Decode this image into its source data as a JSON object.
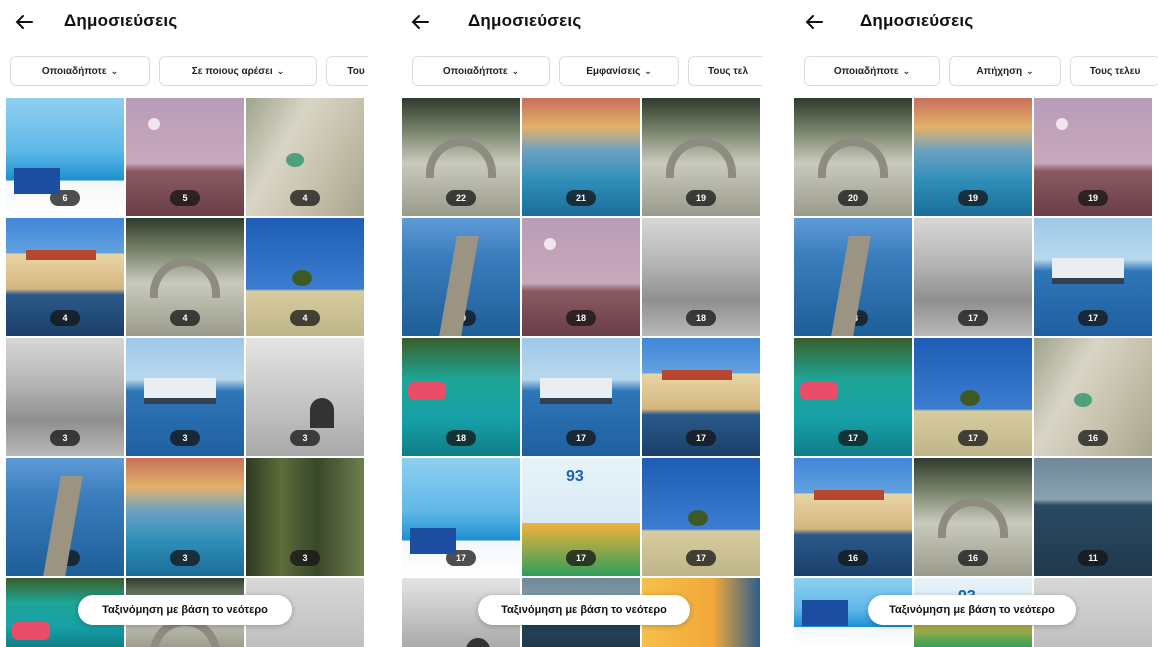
{
  "panels": [
    {
      "title": "Δημοσιεύσεις",
      "filters": [
        {
          "label": "Οποιαδήποτε"
        },
        {
          "label": "Σε ποιους αρέσει"
        },
        {
          "label": "Του"
        }
      ],
      "posts": [
        {
          "thumb": "travel",
          "count": "6"
        },
        {
          "thumb": "moon",
          "count": "5"
        },
        {
          "thumb": "sand",
          "count": "4"
        },
        {
          "thumb": "townhall",
          "count": "4"
        },
        {
          "thumb": "bridge",
          "count": "4"
        },
        {
          "thumb": "tree",
          "count": "4"
        },
        {
          "thumb": "bwruins",
          "count": "3"
        },
        {
          "thumb": "boat",
          "count": "3"
        },
        {
          "thumb": "bwrock",
          "count": "3"
        },
        {
          "thumb": "harbor",
          "count": "3"
        },
        {
          "thumb": "colortown",
          "count": "3"
        },
        {
          "thumb": "forest",
          "count": "3"
        }
      ],
      "sort_label": "Ταξινόμηση με βάση το νεότερο"
    },
    {
      "title": "Δημοσιεύσεις",
      "filters": [
        {
          "label": "Οποιαδήποτε"
        },
        {
          "label": "Εμφανίσεις"
        },
        {
          "label": "Τους τελ"
        }
      ],
      "posts": [
        {
          "thumb": "bridge",
          "count": "22"
        },
        {
          "thumb": "colortown",
          "count": "21"
        },
        {
          "thumb": "bridge",
          "count": "19"
        },
        {
          "thumb": "harbor",
          "count": "19"
        },
        {
          "thumb": "moon",
          "count": "18"
        },
        {
          "thumb": "bwruins",
          "count": "18"
        },
        {
          "thumb": "aqua",
          "count": "18"
        },
        {
          "thumb": "boat",
          "count": "17"
        },
        {
          "thumb": "townhall",
          "count": "17"
        },
        {
          "thumb": "travel",
          "count": "17"
        },
        {
          "thumb": "promo",
          "count": "17"
        },
        {
          "thumb": "tree",
          "count": "17"
        }
      ],
      "sort_label": "Ταξινόμηση με βάση το νεότερο"
    },
    {
      "title": "Δημοσιεύσεις",
      "filters": [
        {
          "label": "Οποιαδήποτε"
        },
        {
          "label": "Απήχηση"
        },
        {
          "label": "Τους τελευ"
        }
      ],
      "posts": [
        {
          "thumb": "bridge",
          "count": "20"
        },
        {
          "thumb": "colortown",
          "count": "19"
        },
        {
          "thumb": "moon",
          "count": "19"
        },
        {
          "thumb": "harbor",
          "count": "18"
        },
        {
          "thumb": "bwruins",
          "count": "17"
        },
        {
          "thumb": "boat",
          "count": "17"
        },
        {
          "thumb": "aqua",
          "count": "17"
        },
        {
          "thumb": "tree",
          "count": "17"
        },
        {
          "thumb": "sand",
          "count": "16"
        },
        {
          "thumb": "townhall",
          "count": "16"
        },
        {
          "thumb": "bridge",
          "count": "16"
        },
        {
          "thumb": "marina",
          "count": "11"
        }
      ],
      "sort_label": "Ταξινόμηση με βάση το νεότερο"
    }
  ]
}
